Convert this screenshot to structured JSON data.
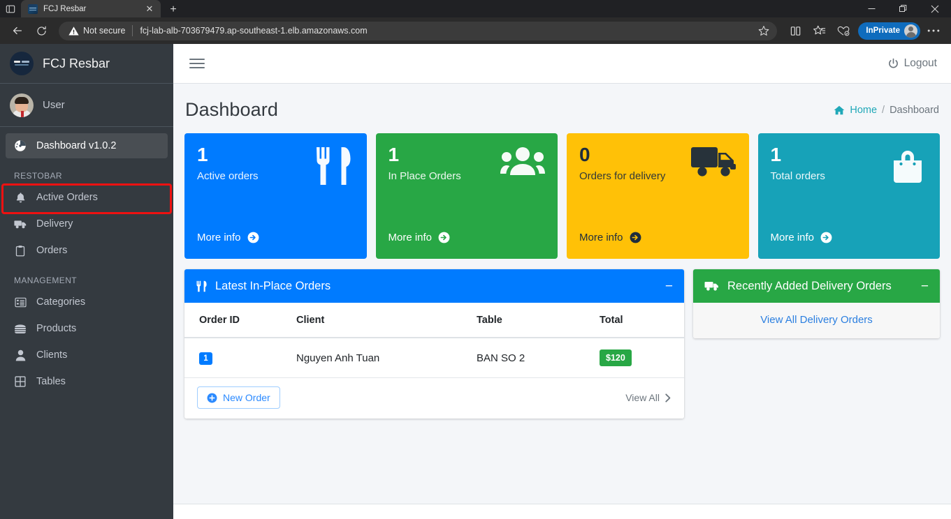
{
  "browser": {
    "tab": {
      "title": "FCJ Resbar",
      "favicon": "fcj-resbar-favicon",
      "close_icon": "close-icon"
    },
    "new_tab_label": "+",
    "tab_search_icon": "tab-search-icon",
    "window_controls": {
      "minimize": "minimize-icon",
      "restore": "restore-icon",
      "close": "close-icon"
    },
    "toolbar": {
      "back_icon": "back-arrow-icon",
      "reload_icon": "reload-icon",
      "security_label": "Not secure",
      "security_icon": "warning-triangle-icon",
      "url": "fcj-lab-alb-703679479.ap-southeast-1.elb.amazonaws.com",
      "favorite_icon": "star-icon",
      "split_screen_icon": "split-screen-icon",
      "collections_icon": "collections-icon",
      "browser_essentials_icon": "browser-essentials-icon",
      "profile_label": "InPrivate",
      "settings_icon": "ellipsis-icon"
    }
  },
  "sidebar": {
    "brand": {
      "label": "FCJ Resbar",
      "logo": "fcj-logo"
    },
    "user": {
      "label": "User",
      "avatar": "user-avatar"
    },
    "primary_item": {
      "label": "Dashboard v1.0.2",
      "icon": "tachometer-icon",
      "active": true,
      "highlighted": true
    },
    "sections": [
      {
        "header": "RESTOBAR",
        "items": [
          {
            "label": "Active Orders",
            "icon": "bell-icon"
          },
          {
            "label": "Delivery",
            "icon": "truck-icon"
          },
          {
            "label": "Orders",
            "icon": "clipboard-icon"
          }
        ]
      },
      {
        "header": "MANAGEMENT",
        "items": [
          {
            "label": "Categories",
            "icon": "list-alt-icon"
          },
          {
            "label": "Products",
            "icon": "hamburger-food-icon"
          },
          {
            "label": "Clients",
            "icon": "user-icon"
          },
          {
            "label": "Tables",
            "icon": "table-grid-icon"
          }
        ]
      }
    ]
  },
  "topnav": {
    "menu_toggle_icon": "hamburger-icon",
    "logout_label": "Logout",
    "logout_icon": "power-icon"
  },
  "page": {
    "title": "Dashboard",
    "breadcrumb": {
      "home_label": "Home",
      "home_icon": "home-icon",
      "separator": "/",
      "current": "Dashboard"
    }
  },
  "cards": [
    {
      "value": "1",
      "label": "Active orders",
      "more_info": "More info",
      "icon": "utensils-icon",
      "color": "#007bff"
    },
    {
      "value": "1",
      "label": "In Place Orders",
      "more_info": "More info",
      "icon": "users-icon",
      "color": "#28a745"
    },
    {
      "value": "0",
      "label": "Orders for delivery",
      "more_info": "More info",
      "icon": "truck-icon",
      "color": "#ffc107"
    },
    {
      "value": "1",
      "label": "Total orders",
      "more_info": "More info",
      "icon": "shopping-bag-icon",
      "color": "#17a2b8"
    }
  ],
  "inplace_panel": {
    "title": "Latest In-Place Orders",
    "icon": "utensils-icon",
    "collapse_icon": "minus-icon",
    "columns": [
      "Order ID",
      "Client",
      "Table",
      "Total"
    ],
    "rows": [
      {
        "order_id": "1",
        "client": "Nguyen Anh Tuan",
        "table": "BAN SO 2",
        "total": "$120"
      }
    ],
    "new_order_label": "New Order",
    "new_order_icon": "plus-circle-icon",
    "view_all_label": "View All",
    "view_all_icon": "chevron-right-icon"
  },
  "delivery_panel": {
    "title": "Recently Added Delivery Orders",
    "icon": "truck-icon",
    "collapse_icon": "minus-icon",
    "view_all_label": "View All Delivery Orders"
  }
}
